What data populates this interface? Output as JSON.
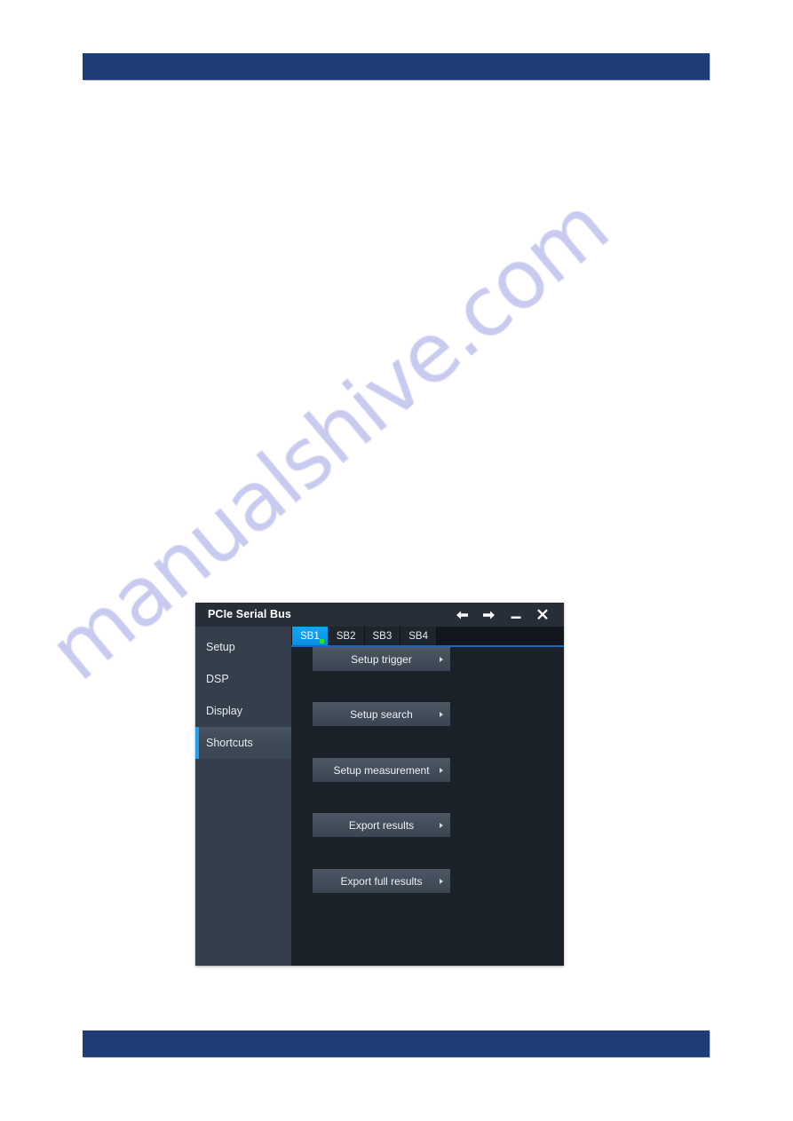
{
  "page": {
    "background_color": "#ffffff",
    "rule_color": "#1d3c78",
    "watermark": "manualshive.com",
    "watermark_color": "#b3b7ea"
  },
  "dialog": {
    "title": "PCIe Serial Bus",
    "window_controls": [
      {
        "name": "back-arrow",
        "glyph": "←"
      },
      {
        "name": "forward-arrow",
        "glyph": "→"
      },
      {
        "name": "minimize",
        "glyph": "—"
      },
      {
        "name": "close",
        "glyph": "✕"
      }
    ],
    "sidebar": {
      "items": [
        {
          "label": "Setup",
          "active": false
        },
        {
          "label": "DSP",
          "active": false
        },
        {
          "label": "Display",
          "active": false
        },
        {
          "label": "Shortcuts",
          "active": true
        }
      ],
      "accent_color": "#1e9ff2",
      "background_color": "#343f4b"
    },
    "tabs": [
      {
        "label": "SB1",
        "active": true,
        "indicator": "green-dot"
      },
      {
        "label": "SB2",
        "active": false
      },
      {
        "label": "SB3",
        "active": false
      },
      {
        "label": "SB4",
        "active": false
      }
    ],
    "tab_active_color": "#0d9bf0",
    "tab_indicator_color": "#2ee02e",
    "shortcuts": [
      {
        "label": "Setup trigger",
        "has_submenu": true
      },
      {
        "label": "Setup search",
        "has_submenu": true
      },
      {
        "label": "Setup measurement",
        "has_submenu": true
      },
      {
        "label": "Export results",
        "has_submenu": true
      },
      {
        "label": "Export full results",
        "has_submenu": true
      }
    ],
    "panel_background_color": "#1b2128",
    "titlebar_color": "#272e38"
  }
}
